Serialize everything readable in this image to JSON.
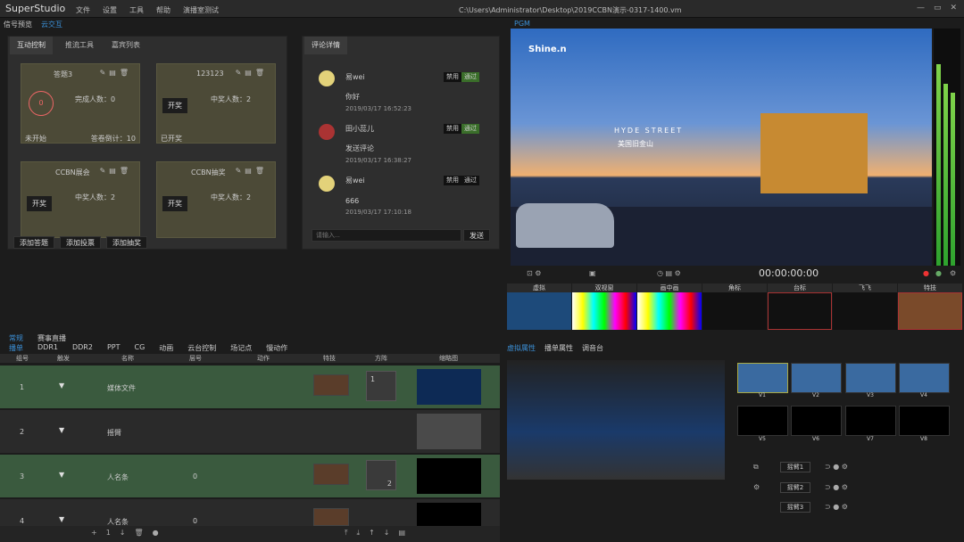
{
  "app": {
    "title": "SuperStudio",
    "menu": [
      "文件",
      "设置",
      "工具",
      "帮助",
      "演播室测试"
    ],
    "path": "C:\\Users\\Administrator\\Desktop\\2019CCBN演示-0317-1400.vm"
  },
  "signal": {
    "label": "信号预览",
    "cloud": "云交互"
  },
  "interactive": {
    "tabs": [
      "互动控制",
      "推流工具",
      "嘉宾列表"
    ],
    "cards": [
      {
        "title": "答题3",
        "line1": "完成人数：0",
        "status": "未开始",
        "extra": "答卷倒计：10",
        "ring": "0"
      },
      {
        "title": "123123",
        "line1": "中奖人数：2",
        "button": "开奖",
        "status": "已开奖"
      },
      {
        "title": "CCBN展会",
        "line1": "中奖人数：2",
        "button": "开奖"
      },
      {
        "title": "CCBN抽奖",
        "line1": "中奖人数：2",
        "button": "开奖"
      }
    ],
    "buttons": [
      "添加答题",
      "添加投票",
      "添加抽奖"
    ]
  },
  "comments": {
    "tab": "评论详情",
    "items": [
      {
        "user": "易wei",
        "text": "你好",
        "time": "2019/03/17 16:52:23"
      },
      {
        "user": "田小蕊儿",
        "text": "发送评论",
        "time": "2019/03/17 16:38:27"
      },
      {
        "user": "易wei",
        "text": "666",
        "time": "2019/03/17 17:10:18"
      }
    ],
    "ban": "禁用",
    "pass": "通过",
    "placeholder": "请输入...",
    "send": "发送"
  },
  "pgm": {
    "label": "PGM",
    "logo": "Shine.n",
    "overlay_line1": "HYDE STREET",
    "overlay_line2": "美国旧金山",
    "timecode": "00:00:00:00"
  },
  "transitions": [
    "虚拟",
    "双视窗",
    "画中画",
    "角标",
    "台标",
    "飞飞",
    "特技"
  ],
  "sources": {
    "modes": [
      "常规",
      "赛事直播"
    ],
    "tabs": [
      "播单",
      "DDR1",
      "DDR2",
      "PPT",
      "CG",
      "动画",
      "云台控制",
      "场记点",
      "慢动作"
    ],
    "columns": [
      "组号",
      "触发",
      "名称",
      "层号",
      "动作",
      "特技",
      "方阵",
      "缩略图"
    ],
    "rows": [
      {
        "num": "1",
        "name": "媒体文件",
        "layer": "",
        "grid": "1"
      },
      {
        "num": "2",
        "name": "摇臂",
        "layer": ""
      },
      {
        "num": "3",
        "name": "人名条",
        "layer": "0",
        "grid": "2"
      },
      {
        "num": "4",
        "name": "人名条",
        "layer": "0"
      }
    ],
    "pager": "1"
  },
  "props": {
    "tabs": [
      "虚拟属性",
      "播单属性",
      "调音台"
    ],
    "thumbs": [
      "V1",
      "V2",
      "V3",
      "V4",
      "V5",
      "V6",
      "V7",
      "V8"
    ],
    "buttons": [
      "摇臂1",
      "摇臂2",
      "摇臂3"
    ]
  }
}
